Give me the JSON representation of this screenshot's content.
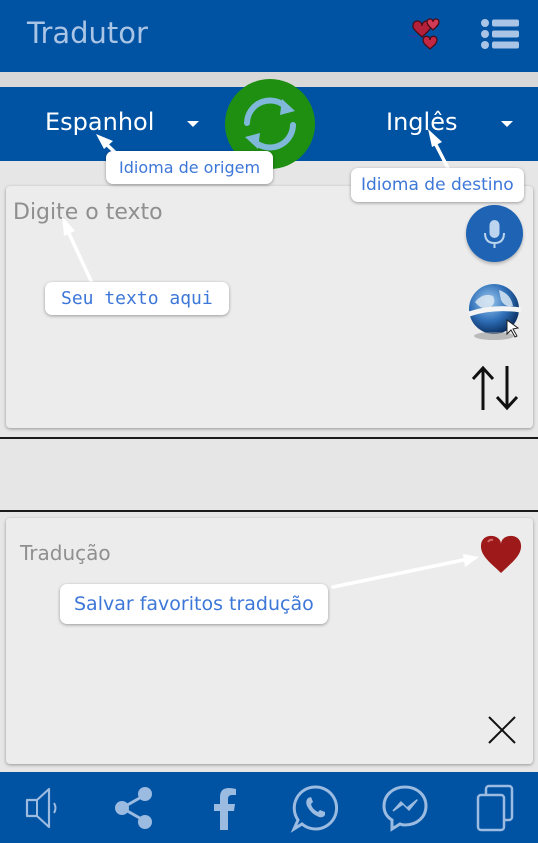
{
  "app": {
    "title": "Tradutor"
  },
  "languages": {
    "source": "Espanhol",
    "target": "Inglês"
  },
  "input": {
    "placeholder": "Digite o texto"
  },
  "output": {
    "placeholder": "Tradução"
  },
  "tooltips": {
    "source_language": "Idioma de origem",
    "target_language": "Idioma de destino",
    "text_input": "Seu texto aqui",
    "save_favorite": "Salvar favoritos tradução"
  },
  "icons": {
    "header": [
      "hearts-icon",
      "menu-list-icon"
    ],
    "input_actions": [
      "microphone-icon",
      "globe-icon",
      "swap-arrows-icon"
    ],
    "output_actions": [
      "heart-icon",
      "close-icon"
    ],
    "bottom_bar": [
      "speaker-icon",
      "share-icon",
      "facebook-icon",
      "whatsapp-icon",
      "messenger-icon",
      "copy-icon"
    ]
  },
  "colors": {
    "primary": "#0052a3",
    "swap_button": "#1f8f12",
    "tooltip_text": "#3d77d8",
    "heart": "#9e1a1a"
  }
}
